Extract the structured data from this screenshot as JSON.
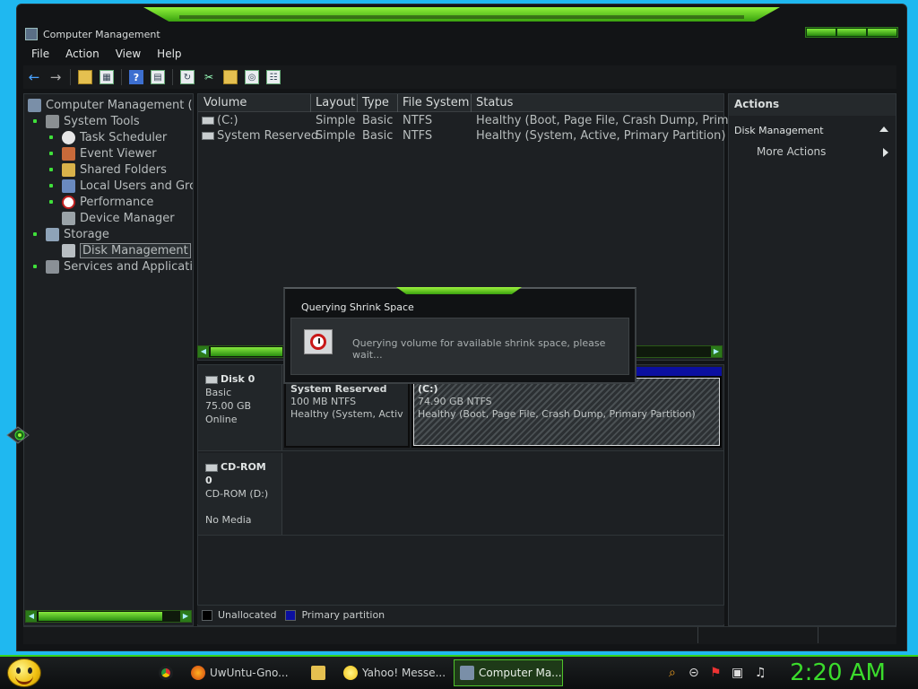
{
  "window": {
    "title": "Computer Management"
  },
  "menu": [
    "File",
    "Action",
    "View",
    "Help"
  ],
  "tree": {
    "root": "Computer Management (Loc",
    "system_tools": "System Tools",
    "task_scheduler": "Task Scheduler",
    "event_viewer": "Event Viewer",
    "shared_folders": "Shared Folders",
    "local_users": "Local Users and Grou",
    "performance": "Performance",
    "device_manager": "Device Manager",
    "storage": "Storage",
    "disk_management": "Disk Management",
    "services": "Services and Applications"
  },
  "volumes": {
    "headers": [
      "Volume",
      "Layout",
      "Type",
      "File System",
      "Status"
    ],
    "rows": [
      {
        "volume": "(C:)",
        "layout": "Simple",
        "type": "Basic",
        "fs": "NTFS",
        "status": "Healthy (Boot, Page File, Crash Dump, Primary"
      },
      {
        "volume": "System Reserved",
        "layout": "Simple",
        "type": "Basic",
        "fs": "NTFS",
        "status": "Healthy (System, Active, Primary Partition)"
      }
    ]
  },
  "disk0": {
    "name": "Disk 0",
    "type": "Basic",
    "size": "75.00 GB",
    "state": "Online",
    "partitions": [
      {
        "name": "System Reserved",
        "size": "100 MB NTFS",
        "status": "Healthy (System, Active, P"
      },
      {
        "name": "(C:)",
        "size": "74.90 GB NTFS",
        "status": "Healthy (Boot, Page File, Crash Dump, Primary Partition)"
      }
    ]
  },
  "cdrom0": {
    "name": "CD-ROM 0",
    "drive": "CD-ROM (D:)",
    "media": "No Media"
  },
  "legend": {
    "unallocated": "Unallocated",
    "primary": "Primary partition",
    "unallocated_color": "#000000",
    "primary_color": "#0b0fa0"
  },
  "actions": {
    "header": "Actions",
    "section": "Disk Management",
    "more": "More Actions"
  },
  "dialog": {
    "title": "Querying Shrink Space",
    "message": "Querying volume for available shrink space, please wait..."
  },
  "taskbar": {
    "items": [
      "UwUntu-Gno...",
      "Yahoo! Messe...",
      "Computer Ma..."
    ],
    "clock": "2:20 AM"
  },
  "colors": {
    "accent": "#3bdc2c",
    "window_bg": "#121416",
    "desktop": "#1fb8f0"
  }
}
